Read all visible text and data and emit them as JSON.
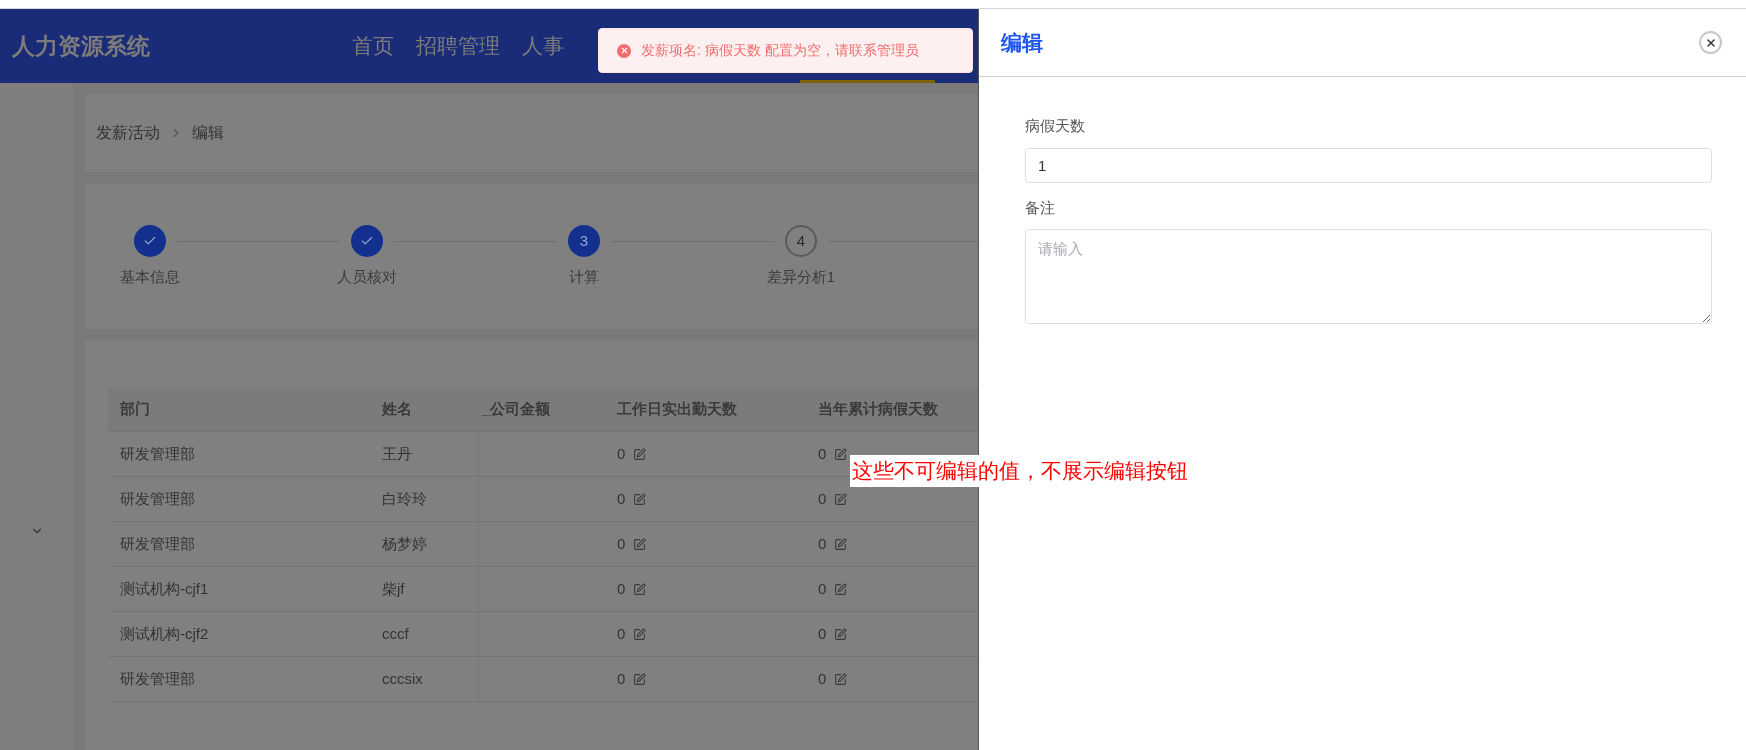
{
  "header": {
    "title": "人力资源系统",
    "nav": [
      {
        "label": "首页",
        "selected": false
      },
      {
        "label": "招聘管理",
        "selected": false
      },
      {
        "label": "人事",
        "selected": false
      }
    ]
  },
  "toast": {
    "message": "发薪项名: 病假天数 配置为空，请联系管理员"
  },
  "breadcrumb": [
    "发薪活动",
    "编辑"
  ],
  "steps": [
    {
      "label": "基本信息",
      "kind": "finish"
    },
    {
      "label": "人员核对",
      "kind": "finish"
    },
    {
      "label": "计算",
      "kind": "process",
      "number": "3"
    },
    {
      "label": "差异分析1",
      "kind": "wait",
      "number": "4"
    }
  ],
  "table": {
    "columns": [
      "部门",
      "姓名",
      "_公司金额",
      "工作日实出勤天数",
      "当年累计病假天数"
    ],
    "rows": [
      {
        "department": "研发管理部",
        "name": "王丹",
        "attendance": {
          "value": "0",
          "edit_icon": true
        },
        "sick_leave": {
          "value": "0",
          "edit_icon": true
        }
      },
      {
        "department": "研发管理部",
        "name": "白玲玲",
        "attendance": {
          "value": "0",
          "edit_icon": true
        },
        "sick_leave": {
          "value": "0",
          "edit_icon": true
        }
      },
      {
        "department": "研发管理部",
        "name": "杨梦婷",
        "attendance": {
          "value": "0",
          "edit_icon": true
        },
        "sick_leave": {
          "value": "0",
          "edit_icon": true
        }
      },
      {
        "department": "测试机构-cjf1",
        "name": "柴jf",
        "attendance": {
          "value": "0",
          "edit_icon": true
        },
        "sick_leave": {
          "value": "0",
          "edit_icon": true
        }
      },
      {
        "department": "测试机构-cjf2",
        "name": "cccf",
        "attendance": {
          "value": "0",
          "edit_icon": true
        },
        "sick_leave": {
          "value": "0",
          "edit_icon": true
        }
      },
      {
        "department": "研发管理部",
        "name": "cccsix",
        "attendance": {
          "value": "0",
          "edit_icon": true
        },
        "sick_leave": {
          "value": "0",
          "edit_icon": true
        }
      }
    ]
  },
  "annotation": "这些不可编辑的值，不展示编辑按钮",
  "drawer": {
    "title": "编辑",
    "fields": [
      {
        "kind": "input",
        "label": "病假天数",
        "value": "1"
      },
      {
        "kind": "textarea",
        "label": "备注",
        "placeholder": "请输入"
      }
    ]
  }
}
